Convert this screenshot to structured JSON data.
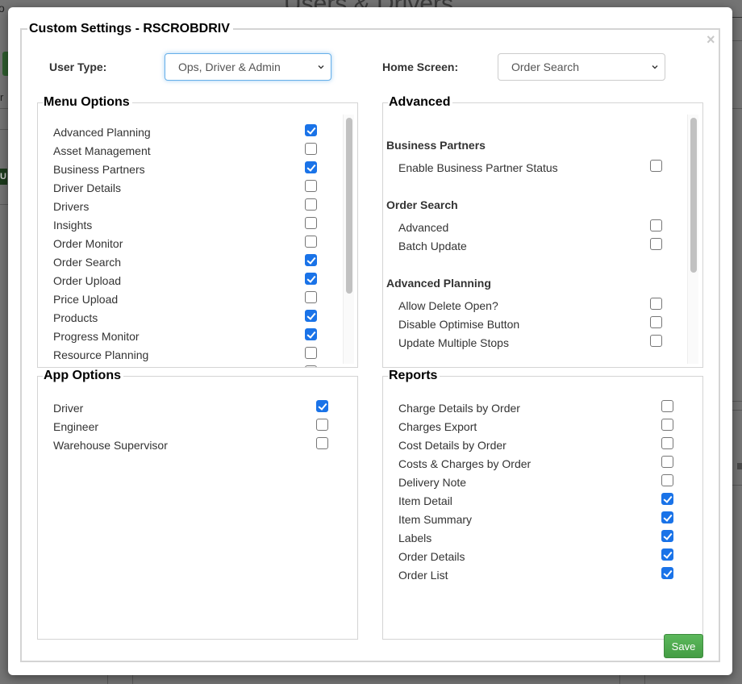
{
  "background_page": {
    "title": "Users & Drivers",
    "left_fragment_1": "o",
    "left_fragment_2": "r",
    "badge_fragment": "U"
  },
  "modal": {
    "title": "Custom Settings - RSCROBDRIV",
    "close_glyph": "×",
    "user_type": {
      "label": "User Type:",
      "value": "Ops, Driver & Admin"
    },
    "home_screen": {
      "label": "Home Screen:",
      "value": "Order Search"
    },
    "menu_options": {
      "title": "Menu Options",
      "items": [
        {
          "label": "Advanced Planning",
          "checked": true
        },
        {
          "label": "Asset Management",
          "checked": false
        },
        {
          "label": "Business Partners",
          "checked": true
        },
        {
          "label": "Driver Details",
          "checked": false
        },
        {
          "label": "Drivers",
          "checked": false
        },
        {
          "label": "Insights",
          "checked": false
        },
        {
          "label": "Order Monitor",
          "checked": false
        },
        {
          "label": "Order Search",
          "checked": true
        },
        {
          "label": "Order Upload",
          "checked": true
        },
        {
          "label": "Price Upload",
          "checked": false
        },
        {
          "label": "Products",
          "checked": true
        },
        {
          "label": "Progress Monitor",
          "checked": true
        },
        {
          "label": "Resource Planning",
          "checked": false
        },
        {
          "label": "",
          "checked": false
        }
      ]
    },
    "advanced": {
      "title": "Advanced",
      "groups": [
        {
          "heading": "Business Partners",
          "items": [
            {
              "label": "Enable Business Partner Status",
              "checked": false
            }
          ]
        },
        {
          "heading": "Order Search",
          "items": [
            {
              "label": "Advanced",
              "checked": false
            },
            {
              "label": "Batch Update",
              "checked": false
            }
          ]
        },
        {
          "heading": "Advanced Planning",
          "items": [
            {
              "label": "Allow Delete Open?",
              "checked": false
            },
            {
              "label": "Disable Optimise Button",
              "checked": false
            },
            {
              "label": "Update Multiple Stops",
              "checked": false
            }
          ]
        }
      ]
    },
    "app_options": {
      "title": "App Options",
      "items": [
        {
          "label": "Driver",
          "checked": true
        },
        {
          "label": "Engineer",
          "checked": false
        },
        {
          "label": "Warehouse Supervisor",
          "checked": false
        }
      ]
    },
    "reports": {
      "title": "Reports",
      "items": [
        {
          "label": "Charge Details by Order",
          "checked": false
        },
        {
          "label": "Charges Export",
          "checked": false
        },
        {
          "label": "Cost Details by Order",
          "checked": false
        },
        {
          "label": "Costs & Charges by Order",
          "checked": false
        },
        {
          "label": "Delivery Note",
          "checked": false
        },
        {
          "label": "Item Detail",
          "checked": true
        },
        {
          "label": "Item Summary",
          "checked": true
        },
        {
          "label": "Labels",
          "checked": true
        },
        {
          "label": "Order Details",
          "checked": true
        },
        {
          "label": "Order List",
          "checked": true
        }
      ]
    },
    "save_label": "Save"
  },
  "colors": {
    "checkbox_checked": "#1a73e8",
    "save_button": "#5cb85c",
    "focus_ring": "#66afe9"
  }
}
